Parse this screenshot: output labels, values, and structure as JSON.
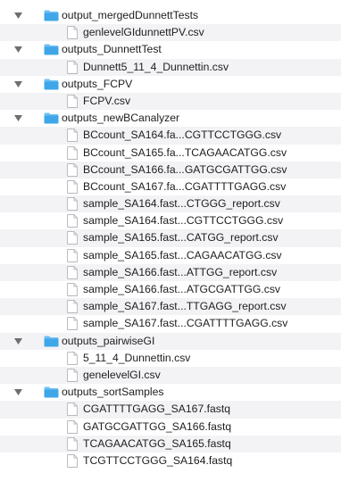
{
  "file_tree": {
    "rows": [
      {
        "type": "folder",
        "label": "output_mergedDunnettTests",
        "expanded": true,
        "alt": false
      },
      {
        "type": "file",
        "label": "genlevelGIdunnettPV.csv",
        "alt": true
      },
      {
        "type": "folder",
        "label": "outputs_DunnettTest",
        "expanded": true,
        "alt": false
      },
      {
        "type": "file",
        "label": "Dunnett5_11_4_Dunnettin.csv",
        "alt": true
      },
      {
        "type": "folder",
        "label": "outputs_FCPV",
        "expanded": true,
        "alt": false
      },
      {
        "type": "file",
        "label": "FCPV.csv",
        "alt": true
      },
      {
        "type": "folder",
        "label": "outputs_newBCanalyzer",
        "expanded": true,
        "alt": false
      },
      {
        "type": "file",
        "label": "BCcount_SA164.fa...CGTTCCTGGG.csv",
        "alt": true
      },
      {
        "type": "file",
        "label": "BCcount_SA165.fa...TCAGAACATGG.csv",
        "alt": false
      },
      {
        "type": "file",
        "label": "BCcount_SA166.fa...GATGCGATTGG.csv",
        "alt": true
      },
      {
        "type": "file",
        "label": "BCcount_SA167.fa...CGATTTTGAGG.csv",
        "alt": false
      },
      {
        "type": "file",
        "label": "sample_SA164.fast...CTGGG_report.csv",
        "alt": true
      },
      {
        "type": "file",
        "label": "sample_SA164.fast...CGTTCCTGGG.csv",
        "alt": false
      },
      {
        "type": "file",
        "label": "sample_SA165.fast...CATGG_report.csv",
        "alt": true
      },
      {
        "type": "file",
        "label": "sample_SA165.fast...CAGAACATGG.csv",
        "alt": false
      },
      {
        "type": "file",
        "label": "sample_SA166.fast...ATTGG_report.csv",
        "alt": true
      },
      {
        "type": "file",
        "label": "sample_SA166.fast...ATGCGATTGG.csv",
        "alt": false
      },
      {
        "type": "file",
        "label": "sample_SA167.fast...TTGAGG_report.csv",
        "alt": true
      },
      {
        "type": "file",
        "label": "sample_SA167.fast...CGATTTTGAGG.csv",
        "alt": false
      },
      {
        "type": "folder",
        "label": "outputs_pairwiseGI",
        "expanded": true,
        "alt": true
      },
      {
        "type": "file",
        "label": "5_11_4_Dunnettin.csv",
        "alt": false
      },
      {
        "type": "file",
        "label": "genelevelGI.csv",
        "alt": true
      },
      {
        "type": "folder",
        "label": "outputs_sortSamples",
        "expanded": true,
        "alt": false
      },
      {
        "type": "file",
        "label": "CGATTTTGAGG_SA167.fastq",
        "alt": true
      },
      {
        "type": "file",
        "label": "GATGCGATTGG_SA166.fastq",
        "alt": false
      },
      {
        "type": "file",
        "label": "TCAGAACATGG_SA165.fastq",
        "alt": true
      },
      {
        "type": "file",
        "label": "TCGTTCCTGGG_SA164.fastq",
        "alt": false
      }
    ]
  },
  "colors": {
    "folder": "#3fa6e8",
    "folder_tab": "#6ec0f2",
    "disclosure": "#6e6e73",
    "file_outline": "#b8b8bd",
    "text": "#1d1d1f",
    "alt_row": "#f3f3f5"
  },
  "icons": {
    "folder": "folder-icon",
    "file": "document-icon",
    "disclosure": "disclosure-triangle-down-icon"
  }
}
